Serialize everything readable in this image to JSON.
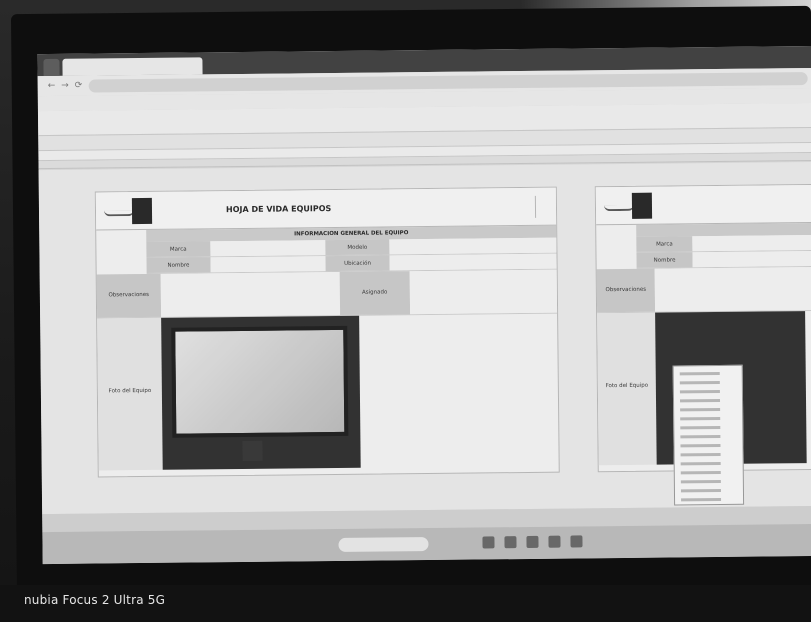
{
  "sheet": {
    "title": "HOJA DE VIDA EQUIPOS",
    "section": "INFORMACION GENERAL DEL EQUIPO",
    "labels": {
      "marca": "Marca",
      "modelo": "Modelo",
      "nombre": "Nombre",
      "ubicacion": "Ubicación",
      "observaciones": "Observaciones",
      "asignado": "Asignado",
      "foto": "Foto del Equipo"
    }
  },
  "watermark": {
    "device": "nubia Focus 2 Ultra 5G"
  }
}
